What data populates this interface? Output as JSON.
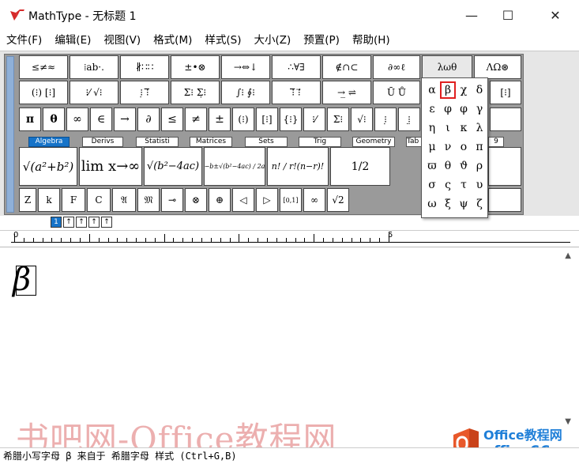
{
  "titlebar": {
    "title": "MathType - 无标题 1",
    "minimize": "—",
    "maximize": "☐",
    "close": "✕"
  },
  "menu": [
    "文件(F)",
    "编辑(E)",
    "视图(V)",
    "格式(M)",
    "样式(S)",
    "大小(Z)",
    "预置(P)",
    "帮助(H)"
  ],
  "toolbar_row1": [
    "≤≠≈",
    "⁞ab·.",
    "∦∷∷",
    "±•⊗",
    "→⇔↓",
    "∴∀∃",
    "∉∩⊂",
    "∂∞ℓ",
    "λωθ",
    "ΛΩ⊛"
  ],
  "toolbar_row2": [
    "(⁝) [⁝]",
    "⁝⁄ √⁝",
    "⁝̣ ⁝̅",
    "Σ⁝ Σ̣⁝",
    "∫⁝ ∮⁝",
    "⁝̅ ⁝⃗",
    "→̲ ⇌",
    "Ū Ů",
    "",
    "[⁝]"
  ],
  "toolbar_row3": [
    "π",
    "θ",
    "∞",
    "∈",
    "→",
    "∂",
    "≤",
    "≠",
    "±",
    "(⁝)",
    "[⁝]",
    "{⁝}",
    "⁝⁄",
    "Σ⁝",
    "√⁝",
    "⁝̣",
    "⁝̤"
  ],
  "tabs": [
    "Algebra",
    "Derivs",
    "Statisti",
    "Matrices",
    "Sets",
    "Trig",
    "Geometry",
    "Tab 8",
    "9"
  ],
  "templates": [
    "√(a²+b²)",
    "lim x→∞",
    "√(b²−4ac)",
    "−b±√(b²−4ac) / 2a",
    "n! / r!(n−r)!",
    "1/2"
  ],
  "toolbar_row6": [
    "Z",
    "k",
    "F",
    "C",
    "𝔄",
    "𝔐",
    "⊸",
    "⊗",
    "⊕",
    "◁",
    "▷",
    "[0,1]",
    "∞",
    "√2"
  ],
  "greek_popup": {
    "rows": [
      [
        "α",
        "β",
        "χ",
        "δ"
      ],
      [
        "ε",
        "φ",
        "φ",
        "γ"
      ],
      [
        "η",
        "ι",
        "κ",
        "λ"
      ],
      [
        "μ",
        "ν",
        "ο",
        "π"
      ],
      [
        "ϖ",
        "θ",
        "ϑ",
        "ρ"
      ],
      [
        "σ",
        "ς",
        "τ",
        "υ"
      ],
      [
        "ω",
        "ξ",
        "ψ",
        "ζ"
      ]
    ],
    "selected": "β"
  },
  "mini_tabs": [
    "1",
    "↑",
    "↑",
    "↑",
    "↑"
  ],
  "ruler": {
    "labels": [
      "0",
      "5"
    ]
  },
  "editor": {
    "content": "β"
  },
  "watermark": {
    "text": "书吧网-Office教程网",
    "brand_line1": "Office教程网",
    "brand_line2": "office66.cn"
  },
  "status": {
    "text": "希腊小写字母 β 来自于 希腊字母 样式 (Ctrl+G,B)"
  },
  "colors": {
    "tab_active": "#1673c8",
    "selected_border": "#e02020",
    "grip": "#8fb0d8"
  }
}
